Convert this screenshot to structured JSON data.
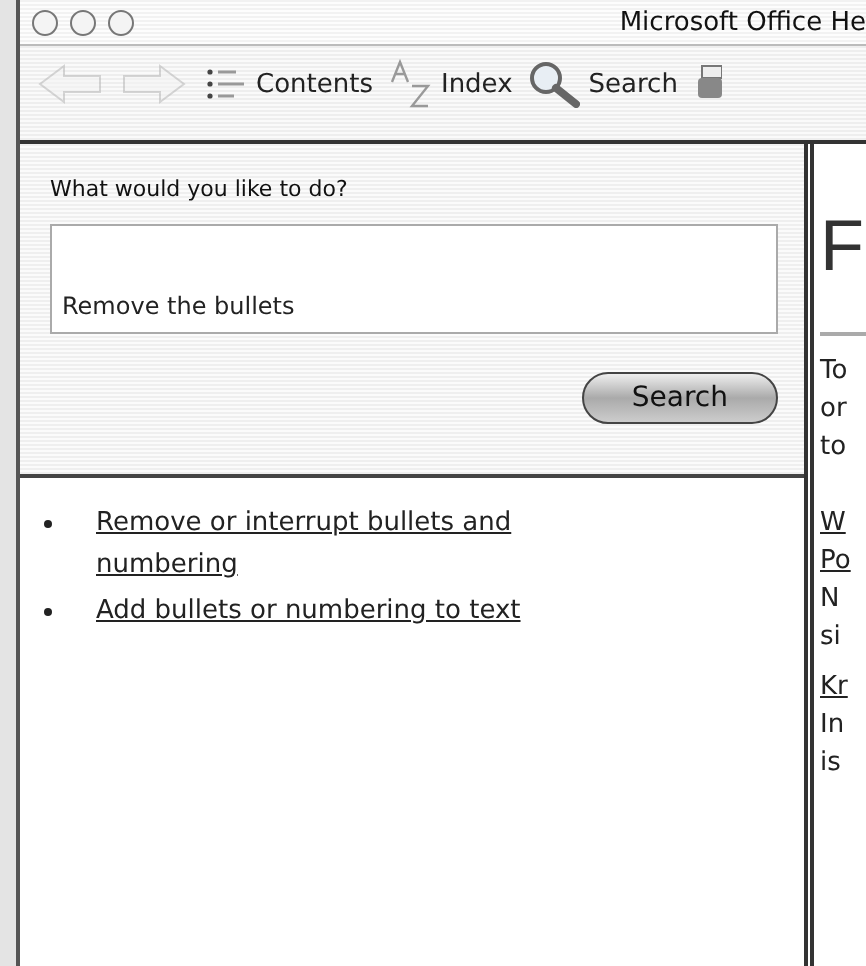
{
  "window": {
    "title": "Microsoft Office He"
  },
  "toolbar": [
    {
      "kind": "back",
      "disabled": true
    },
    {
      "kind": "forward",
      "disabled": true
    },
    {
      "kind": "contents",
      "label": "Contents",
      "disabled": false
    },
    {
      "kind": "index",
      "label": "Index",
      "disabled": false
    },
    {
      "kind": "search",
      "label": "Search",
      "disabled": false
    },
    {
      "kind": "print",
      "disabled": false
    }
  ],
  "question": {
    "label": "What would you like to do?",
    "value": "Remove the bullets",
    "button": "Search"
  },
  "results": [
    "Remove or interrupt bullets and numbering",
    "Add bullets or numbering to text"
  ],
  "article": {
    "heading": "F",
    "lines": [
      {
        "kind": "text",
        "text": "To"
      },
      {
        "kind": "text",
        "text": "or"
      },
      {
        "kind": "text",
        "text": "to"
      },
      {
        "kind": "gap"
      },
      {
        "kind": "link",
        "text": "W"
      },
      {
        "kind": "link",
        "text": "Po"
      },
      {
        "kind": "text",
        "text": "N"
      },
      {
        "kind": "text",
        "text": "si"
      },
      {
        "kind": "small-gap"
      },
      {
        "kind": "link",
        "text": "Kr"
      },
      {
        "kind": "text",
        "text": "In"
      },
      {
        "kind": "text",
        "text": "is"
      }
    ]
  }
}
